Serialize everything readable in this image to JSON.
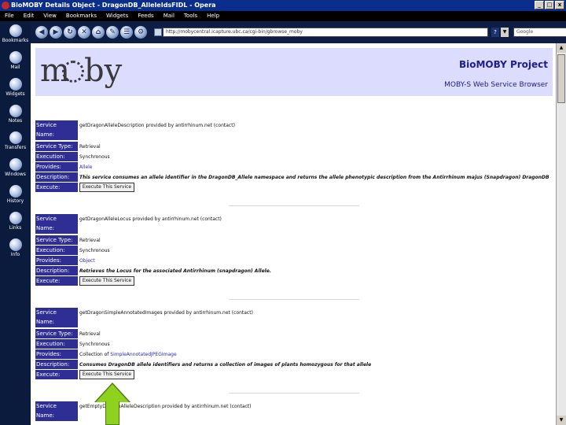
{
  "window": {
    "title": "BioMOBY Details Object - DragonDB_AlleleIdsFIDL - Opera",
    "controls": [
      "_",
      "□",
      "x"
    ]
  },
  "menu": [
    "File",
    "Edit",
    "View",
    "Bookmarks",
    "Widgets",
    "Feeds",
    "Mail",
    "Tools",
    "Help"
  ],
  "panel": [
    {
      "label": "Bookmarks",
      "icon": "bookmarks-icon"
    },
    {
      "label": "Mail",
      "icon": "mail-icon"
    },
    {
      "label": "Widgets",
      "icon": "widgets-icon"
    },
    {
      "label": "Notes",
      "icon": "notes-icon"
    },
    {
      "label": "Transfers",
      "icon": "transfers-icon"
    },
    {
      "label": "Windows",
      "icon": "windows-icon"
    },
    {
      "label": "History",
      "icon": "history-icon"
    },
    {
      "label": "Links",
      "icon": "links-icon"
    },
    {
      "label": "Info",
      "icon": "info-icon"
    }
  ],
  "toolbar": {
    "address": "http://mobycentral.icapture.ubc.ca/cgi-bin/gbrowse_moby",
    "help": "?",
    "search_engine": "Google",
    "buttons": [
      "◀",
      "▶",
      "↻",
      "✕",
      "⌂",
      "✎",
      "☰",
      "⚙"
    ]
  },
  "header": {
    "logo_m": "m",
    "logo_by": "by",
    "project": "BioMOBY Project",
    "subtitle": "MOBY-S Web Service Browser"
  },
  "labels": {
    "service_name_1": "Service",
    "service_name_2": "Name:",
    "service_type": "Service Type:",
    "execution": "Execution:",
    "provides": "Provides:",
    "description": "Description:",
    "execute": "Execute:"
  },
  "execute_button": "Execute This Service",
  "services": [
    {
      "name": "getDragonAlleleDescription provided by antirrhinum.net (contact)",
      "type": "Retrieval",
      "execution": "Synchronous",
      "provides": "Allele",
      "description": "This service consumes an allele identifier in the DragonDB_Allele namespace and returns the allele phenotypic description from the Antirrhinum majus (Snapdragon) DragonDB database."
    },
    {
      "name": "getDragonAlleleLocus provided by antirrhinum.net (contact)",
      "type": "Retrieval",
      "execution": "Synchronous",
      "provides": "Object",
      "description": "Retrieves the Locus for the associated Antirrhinum (snapdragon) Allele."
    },
    {
      "name": "getDragonSimpleAnnotatedImages provided by antirrhinum.net (contact)",
      "type": "Retrieval",
      "execution": "Synchronous",
      "provides_prefix": "Collection of",
      "provides": "SimpleAnnotatedJPEGImage",
      "description": "Consumes DragonDB allele identifiers and returns a collection of images of plants homozygous for that allele"
    },
    {
      "name": "getEmptyDomainAlleleDescription provided by antirrhinum.net (contact)"
    }
  ],
  "colors": {
    "label_bg": "#2e2e94",
    "header_band": "#dcdcff",
    "panel_bg": "#0b1b3d",
    "arrow": "#8fd11f"
  }
}
